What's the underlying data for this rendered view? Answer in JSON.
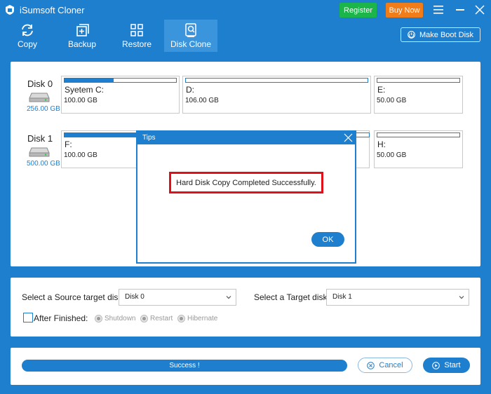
{
  "app": {
    "title": "iSumsoft Cloner"
  },
  "header": {
    "register_label": "Register",
    "buynow_label": "Buy Now"
  },
  "toolbar": {
    "items": [
      {
        "label": "Copy",
        "icon": "copy-icon"
      },
      {
        "label": "Backup",
        "icon": "backup-icon"
      },
      {
        "label": "Restore",
        "icon": "restore-icon"
      },
      {
        "label": "Disk Clone",
        "icon": "disk-clone-icon",
        "active": true
      }
    ],
    "boot_label": "Make Boot Disk"
  },
  "disks": [
    {
      "name": "Disk 0",
      "size": "256.00 GB",
      "partitions": [
        {
          "label": "Syetem C:",
          "size": "100.00 GB",
          "fill": 0.44
        },
        {
          "label": "D:",
          "size": "106.00 GB",
          "fill": 0.0
        },
        {
          "label": "E:",
          "size": "50.00 GB",
          "fill": 0.0
        }
      ]
    },
    {
      "name": "Disk 1",
      "size": "500.00 GB",
      "partitions": [
        {
          "label": "F:",
          "size": "100.00 GB",
          "fill": 0.44
        },
        {
          "label": "H:",
          "size": "50.00 GB",
          "fill": 0.0
        }
      ]
    }
  ],
  "dialog": {
    "title": "Tips",
    "message": "Hard Disk Copy Completed Successfully.",
    "ok_label": "OK"
  },
  "select": {
    "source_label": "Select a Source target disk:",
    "source_value": "Disk 0",
    "target_label": "Select a Target disk:",
    "target_value": "Disk 1",
    "after_label": "After Finished:",
    "options": [
      "Shutdown",
      "Restart",
      "Hibernate"
    ]
  },
  "progress": {
    "text": "Success !",
    "value": 1.0
  },
  "actions": {
    "cancel_label": "Cancel",
    "start_label": "Start"
  },
  "colors": {
    "accent": "#1f7fcf",
    "register": "#1bb54a",
    "buynow": "#f07c1a",
    "highlight": "#e0101a"
  }
}
